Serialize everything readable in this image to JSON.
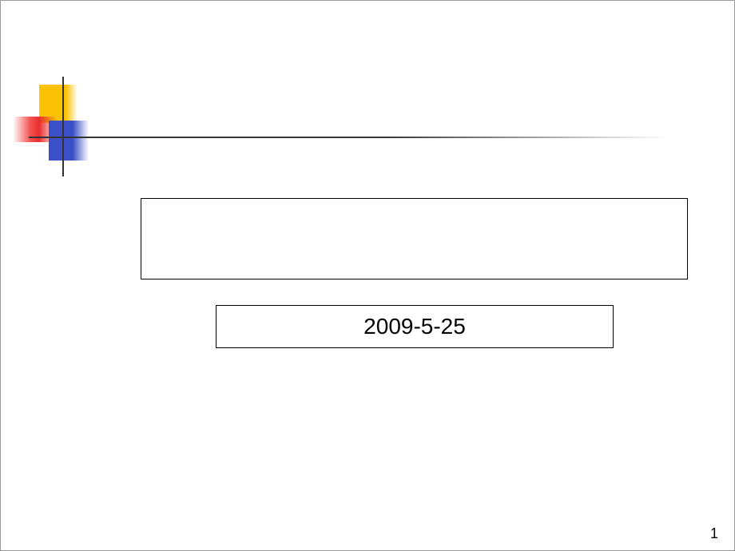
{
  "slide": {
    "title": "",
    "date": "2009-5-25",
    "page_number": "1"
  }
}
